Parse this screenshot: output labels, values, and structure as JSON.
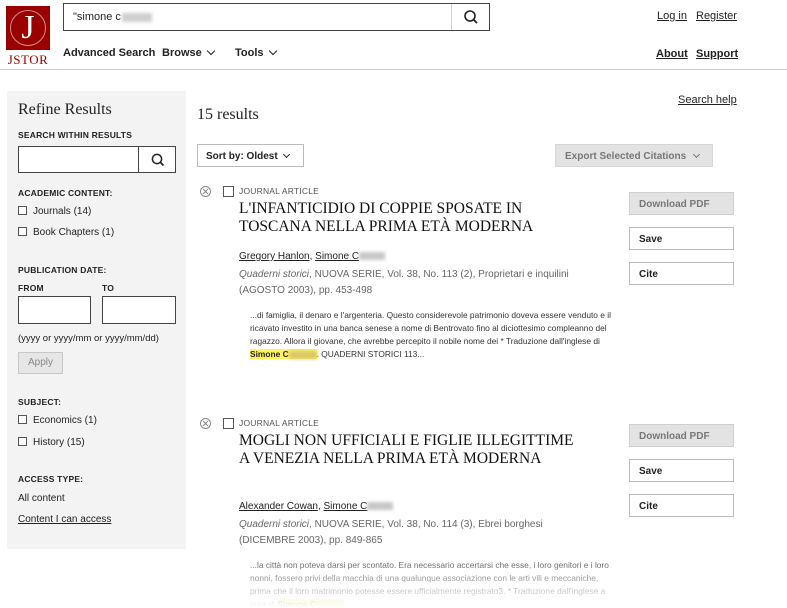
{
  "brand": {
    "logo_text": "JSTOR",
    "color": "#990000"
  },
  "search": {
    "value": "\"simone c",
    "icon": "search-icon"
  },
  "nav": {
    "advanced_search": "Advanced Search",
    "browse": "Browse",
    "tools": "Tools",
    "login": "Log in",
    "register": "Register",
    "about": "About",
    "support": "Support",
    "search_help": "Search help"
  },
  "sidebar": {
    "title": "Refine Results",
    "search_within_label": "SEARCH WITHIN RESULTS",
    "academic_content_label": "ACADEMIC CONTENT:",
    "academic_content": [
      "Journals (14)",
      "Book Chapters (1)"
    ],
    "publication_date_label": "PUBLICATION DATE:",
    "from_label": "FROM",
    "to_label": "TO",
    "date_format_hint": "(yyyy or yyyy/mm or yyyy/mm/dd)",
    "apply_label": "Apply",
    "subject_label": "SUBJECT:",
    "subjects": [
      "Economics (1)",
      "History (15)"
    ],
    "access_type_label": "ACCESS TYPE:",
    "access_all": "All content",
    "access_mine": "Content I can access"
  },
  "results_header": {
    "count": "15 results",
    "sort_label": "Sort by: Oldest",
    "export_label": "Export Selected Citations"
  },
  "actions": {
    "download": "Download PDF",
    "save": "Save",
    "cite": "Cite"
  },
  "results": [
    {
      "type": "JOURNAL ARTICLE",
      "title": "L'INFANTICIDIO DI COPPIE SPOSATE IN TOSCANA NELLA PRIMA ETÀ MODERNA",
      "author1": "Gregory Hanlon",
      "author2": "Simone C",
      "journal": "Quaderni storici",
      "citation": ", NUOVA SERIE, Vol. 38, No. 113 (2), Proprietari e inquilini (AGOSTO 2003), pp. 453-498",
      "snippet_before": "...di famiglia, il denaro e l'argenteria. Questo considerevole patrimonio doveva essere venduto e il ricavato investito in una banca senese a nome di Bentrovato fino al diciottesimo compleanno del ragazzo. Allora il giovane, che avrebbe percepito il nobile nome dei * Traduzione dall'inglese di ",
      "snippet_highlight": "Simone C",
      "snippet_after": ". QUADERNI STORICI 113..."
    },
    {
      "type": "JOURNAL ARTICLE",
      "title": "MOGLI NON UFFICIALI E FIGLIE ILLEGITTIME A VENEZIA NELLA PRIMA ETÀ MODERNA",
      "author1": "Alexander Cowan",
      "author2": "Simone C",
      "journal": "Quaderni storici",
      "citation": ", NUOVA SERIE, Vol. 38, No. 114 (3), Ebrei borghesi (DICEMBRE 2003), pp. 849-865",
      "snippet_before": "...la città non poteva darsi per scontato. Era necessario accertarsi che esse, i loro genitori e i loro nonni, fossero privi della macchia di una qualunque associazione con le arti vili e meccaniche, prima che il loro matrimonio potesse essere ufficialmente registrato3. * Traduzione dall'inglese a cura di ",
      "snippet_highlight": "Simone C",
      "snippet_after": ""
    }
  ]
}
